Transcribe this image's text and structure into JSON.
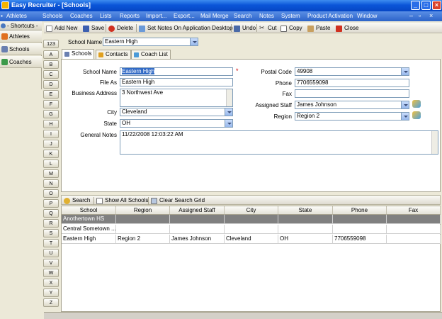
{
  "window": {
    "title": "Easy Recruiter - [Schools]"
  },
  "menu": [
    "Athletes",
    "Schools",
    "Coaches",
    "Lists",
    "Reports",
    "Import...",
    "Export...",
    "Mail Merge",
    "Search",
    "Notes",
    "System",
    "Product Activation",
    "Window"
  ],
  "sidebar": {
    "header": "- Shortcuts -",
    "items": [
      {
        "label": "Athletes",
        "color": "#e07020"
      },
      {
        "label": "Schools",
        "color": "#6a7fb0"
      },
      {
        "label": "Coaches",
        "color": "#3c9a4a"
      }
    ]
  },
  "alphabet": [
    "123",
    "A",
    "B",
    "C",
    "D",
    "E",
    "F",
    "G",
    "H",
    "I",
    "J",
    "K",
    "L",
    "M",
    "N",
    "O",
    "P",
    "Q",
    "R",
    "S",
    "T",
    "U",
    "V",
    "W",
    "X",
    "Y",
    "Z"
  ],
  "toolbar": {
    "add_new": "Add New",
    "save": "Save",
    "delete": "Delete",
    "set_notes": "Set Notes On Application Desktop",
    "undo": "Undo",
    "cut": "Cut",
    "copy": "Copy",
    "paste": "Paste",
    "close": "Close"
  },
  "school_selector": {
    "label": "School Name",
    "value": "Eastern High"
  },
  "tabs": [
    "Schools",
    "Contacts",
    "Coach List"
  ],
  "form": {
    "school_name": {
      "label": "School Name",
      "value": "Eastern High",
      "required": "*"
    },
    "file_as": {
      "label": "File As",
      "value": "Eastern High"
    },
    "business_address": {
      "label": "Business Address",
      "value": "3 Northwest Ave"
    },
    "city": {
      "label": "City",
      "value": "Cleveland"
    },
    "state": {
      "label": "State",
      "value": "OH"
    },
    "general_notes": {
      "label": "General Notes",
      "value": "11/22/2008 12:03:22 AM"
    },
    "postal_code": {
      "label": "Postal Code",
      "value": "49908"
    },
    "phone": {
      "label": "Phone",
      "value": "7706559098"
    },
    "fax": {
      "label": "Fax",
      "value": ""
    },
    "assigned_staff": {
      "label": "Assigned Staff",
      "value": "James Johnson"
    },
    "region": {
      "label": "Region",
      "value": "Region 2"
    }
  },
  "search_toolbar": {
    "search": "Search",
    "show_all": "Show All Schools",
    "clear": "Clear Search Grid"
  },
  "grid": {
    "columns": [
      "School",
      "Region",
      "Assigned Staff",
      "City",
      "State",
      "Phone",
      "Fax"
    ],
    "rows": [
      [
        "Anothertown HS",
        "",
        "",
        "",
        "",
        "",
        ""
      ],
      [
        "Central Sometown ...",
        "",
        "",
        "",
        "",
        "",
        ""
      ],
      [
        "Eastern High",
        "Region 2",
        "James Johnson",
        "Cleveland",
        "OH",
        "7706559098",
        ""
      ]
    ]
  }
}
